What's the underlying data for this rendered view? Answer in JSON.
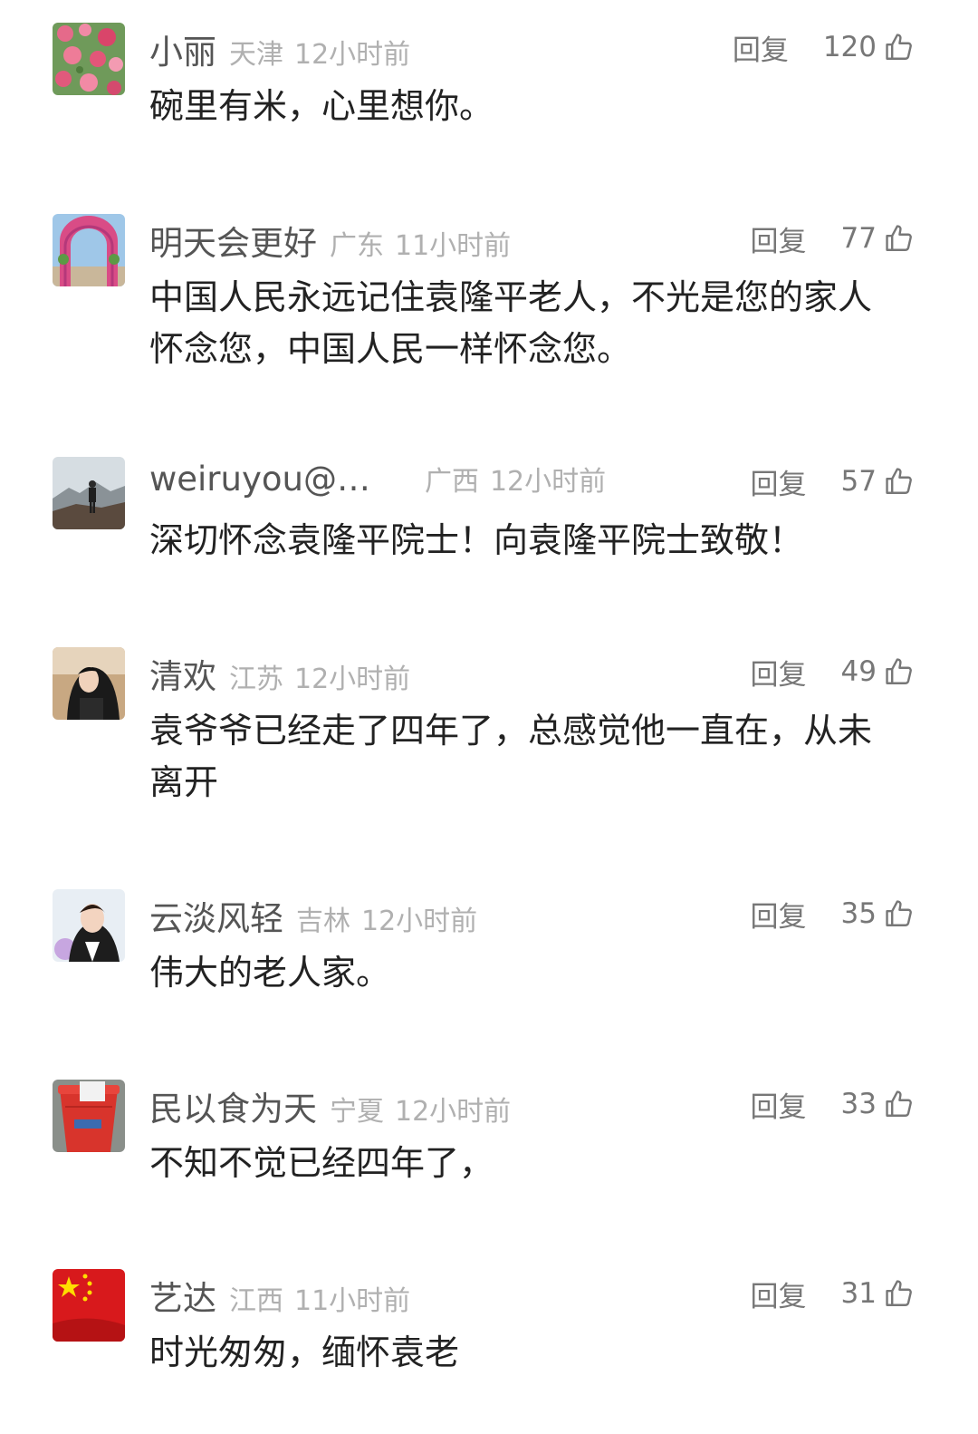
{
  "comments": [
    {
      "username": "小丽",
      "location": "天津",
      "time": "12小时前",
      "reply_label": "回复",
      "likes": "120",
      "text": "碗里有米，心里想你。",
      "avatar": "flowers-photo"
    },
    {
      "username": "明天会更好",
      "location": "广东",
      "time": "11小时前",
      "reply_label": "回复",
      "likes": "77",
      "text": "中国人民永远记住袁隆平老人，不光是您的家人怀念您，中国人民一样怀念您。",
      "avatar": "flower-arch-photo"
    },
    {
      "username": "weiruyou@…",
      "location": "广西",
      "time": "12小时前",
      "reply_label": "回复",
      "likes": "57",
      "text": "深切怀念袁隆平院士！向袁隆平院士致敬！",
      "avatar": "mountain-person-photo"
    },
    {
      "username": "清欢",
      "location": "江苏",
      "time": "12小时前",
      "reply_label": "回复",
      "likes": "49",
      "text": "袁爷爷已经走了四年了，总感觉他一直在，从未离开",
      "avatar": "woman-portrait-photo"
    },
    {
      "username": "云淡风轻",
      "location": "吉林",
      "time": "12小时前",
      "reply_label": "回复",
      "likes": "35",
      "text": "伟大的老人家。",
      "avatar": "woman-selfie-photo"
    },
    {
      "username": "民以食为天",
      "location": "宁夏",
      "time": "12小时前",
      "reply_label": "回复",
      "likes": "33",
      "text": "不知不觉已经四年了，",
      "avatar": "red-bucket-photo"
    },
    {
      "username": "艺达",
      "location": "江西",
      "time": "11小时前",
      "reply_label": "回复",
      "likes": "31",
      "text": "时光匆匆，缅怀袁老",
      "avatar": "china-flag-photo"
    }
  ],
  "icons": {
    "like": "thumbs-up-icon"
  },
  "colors": {
    "username": "#555555",
    "meta": "#b0b0b0",
    "text": "#222222",
    "action": "#777777"
  }
}
